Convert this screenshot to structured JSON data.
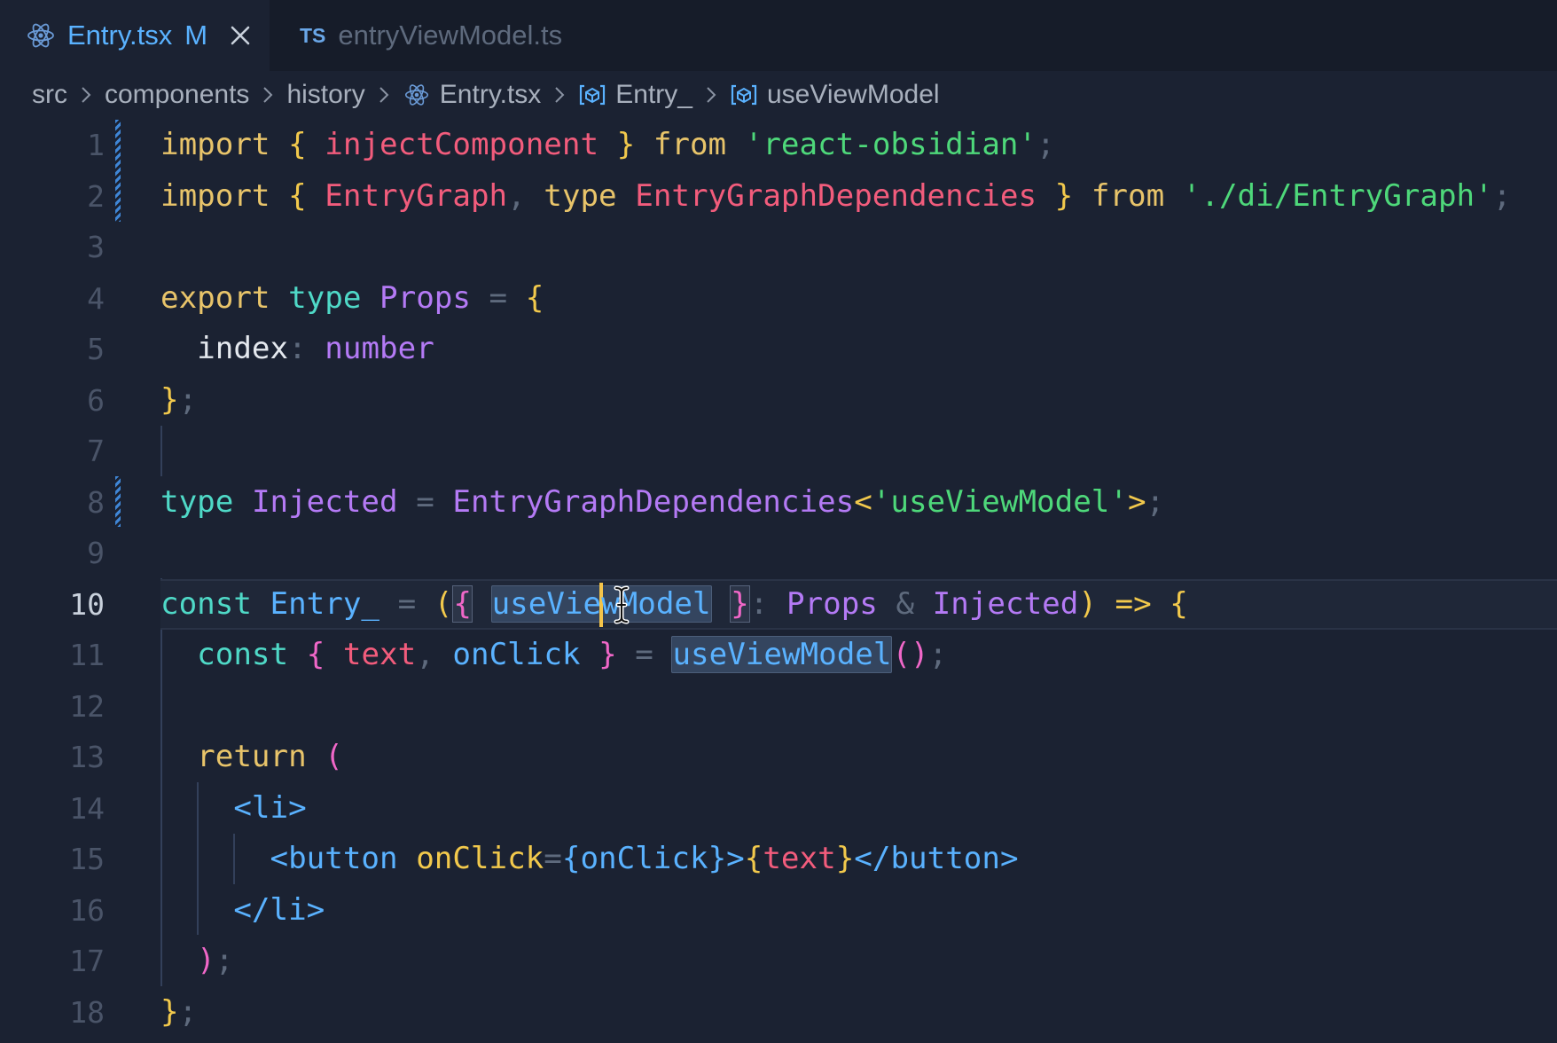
{
  "tabs": [
    {
      "icon": "react-icon",
      "label": "Entry.tsx",
      "status": "M",
      "active": true
    },
    {
      "icon": "typescript-icon",
      "badge": "TS",
      "label": "entryViewModel.ts",
      "active": false
    }
  ],
  "breadcrumb": {
    "items": [
      "src",
      "components",
      "history",
      "Entry.tsx",
      "Entry_",
      "useViewModel"
    ]
  },
  "editor": {
    "current_line": 10,
    "line_numbers": [
      "1",
      "2",
      "3",
      "4",
      "5",
      "6",
      "7",
      "8",
      "9",
      "10",
      "11",
      "12",
      "13",
      "14",
      "15",
      "16",
      "17",
      "18"
    ],
    "lines": [
      "import { injectComponent } from 'react-obsidian';",
      "import { EntryGraph, type EntryGraphDependencies } from './di/EntryGraph';",
      "",
      "export type Props = {",
      "  index: number",
      "};",
      "",
      "type Injected = EntryGraphDependencies<'useViewModel'>;",
      "",
      "const Entry_ = ({ useViewModel }: Props & Injected) => {",
      "  const { text, onClick } = useViewModel();",
      "",
      "  return (",
      "    <li>",
      "      <button onClick={onClick}>{text}</button>",
      "    </li>",
      "  );",
      "};"
    ]
  },
  "colors": {
    "background": "#1b2232",
    "tabbar": "#161c29",
    "keyword": "#e8c46a",
    "declaration_keyword": "#4fd9c7",
    "identifier": "#f25c7c",
    "string": "#4ed87a",
    "type": "#b47af5",
    "function": "#5ab2ff",
    "cursor": "#f4c44a"
  }
}
